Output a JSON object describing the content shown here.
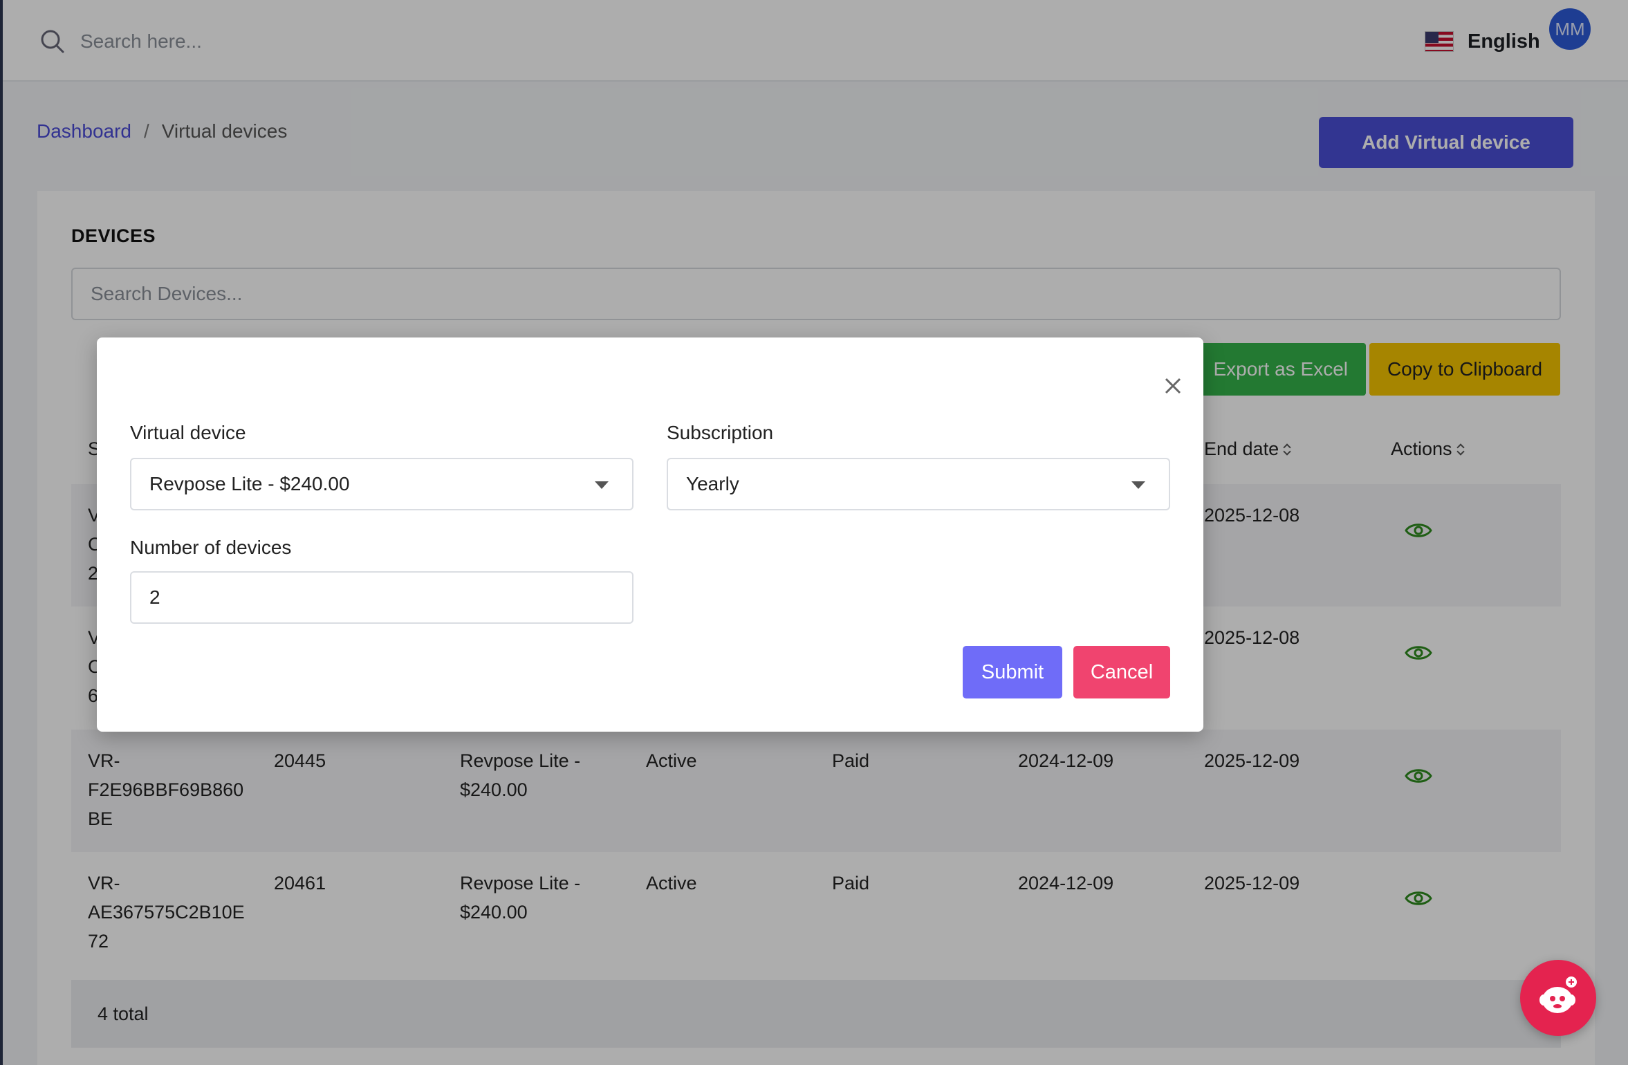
{
  "topbar": {
    "search_placeholder": "Search here...",
    "language": "English",
    "avatar_initials": "MM"
  },
  "breadcrumb": {
    "parent": "Dashboard",
    "separator": "/",
    "current": "Virtual devices"
  },
  "add_button_label": "Add Virtual device",
  "devices": {
    "title": "DEVICES",
    "search_placeholder": "Search Devices...",
    "export_label": "Export as Excel",
    "copy_label": "Copy to Clipboard",
    "columns_visible": {
      "first_partial": "S",
      "end_date": "End date",
      "actions": "Actions"
    },
    "rows": [
      {
        "serial_partial": [
          "V",
          "C",
          "2"
        ],
        "end_date": "2025-12-08"
      },
      {
        "serial_partial": [
          "V",
          "C",
          "6"
        ],
        "end_date": "2025-12-08"
      },
      {
        "serial": [
          "VR-",
          "F2E96BBF69B860",
          "BE"
        ],
        "id": "20445",
        "plan": [
          "Revpose Lite -",
          "$240.00"
        ],
        "status": "Active",
        "payment": "Paid",
        "start_date": "2024-12-09",
        "end_date": "2025-12-09"
      },
      {
        "serial": [
          "VR-",
          "AE367575C2B10E",
          "72"
        ],
        "id": "20461",
        "plan": [
          "Revpose Lite -",
          "$240.00"
        ],
        "status": "Active",
        "payment": "Paid",
        "start_date": "2024-12-09",
        "end_date": "2025-12-09"
      }
    ],
    "total_label": "4 total"
  },
  "modal": {
    "virtual_device_label": "Virtual device",
    "virtual_device_value": "Revpose Lite - $240.00",
    "subscription_label": "Subscription",
    "subscription_value": "Yearly",
    "number_label": "Number of devices",
    "number_value": "2",
    "submit_label": "Submit",
    "cancel_label": "Cancel"
  },
  "colors": {
    "primary": "#4b4fd6",
    "submit": "#6f6cf8",
    "cancel": "#f0446f",
    "export": "#34b34a",
    "copy": "#f5c400",
    "eye": "#2e8b1e",
    "chat": "#e4234f"
  },
  "icons": [
    "search-icon",
    "us-flag-icon",
    "close-icon",
    "chevron-down-icon",
    "eye-icon",
    "sort-icon",
    "chatbot-icon"
  ]
}
